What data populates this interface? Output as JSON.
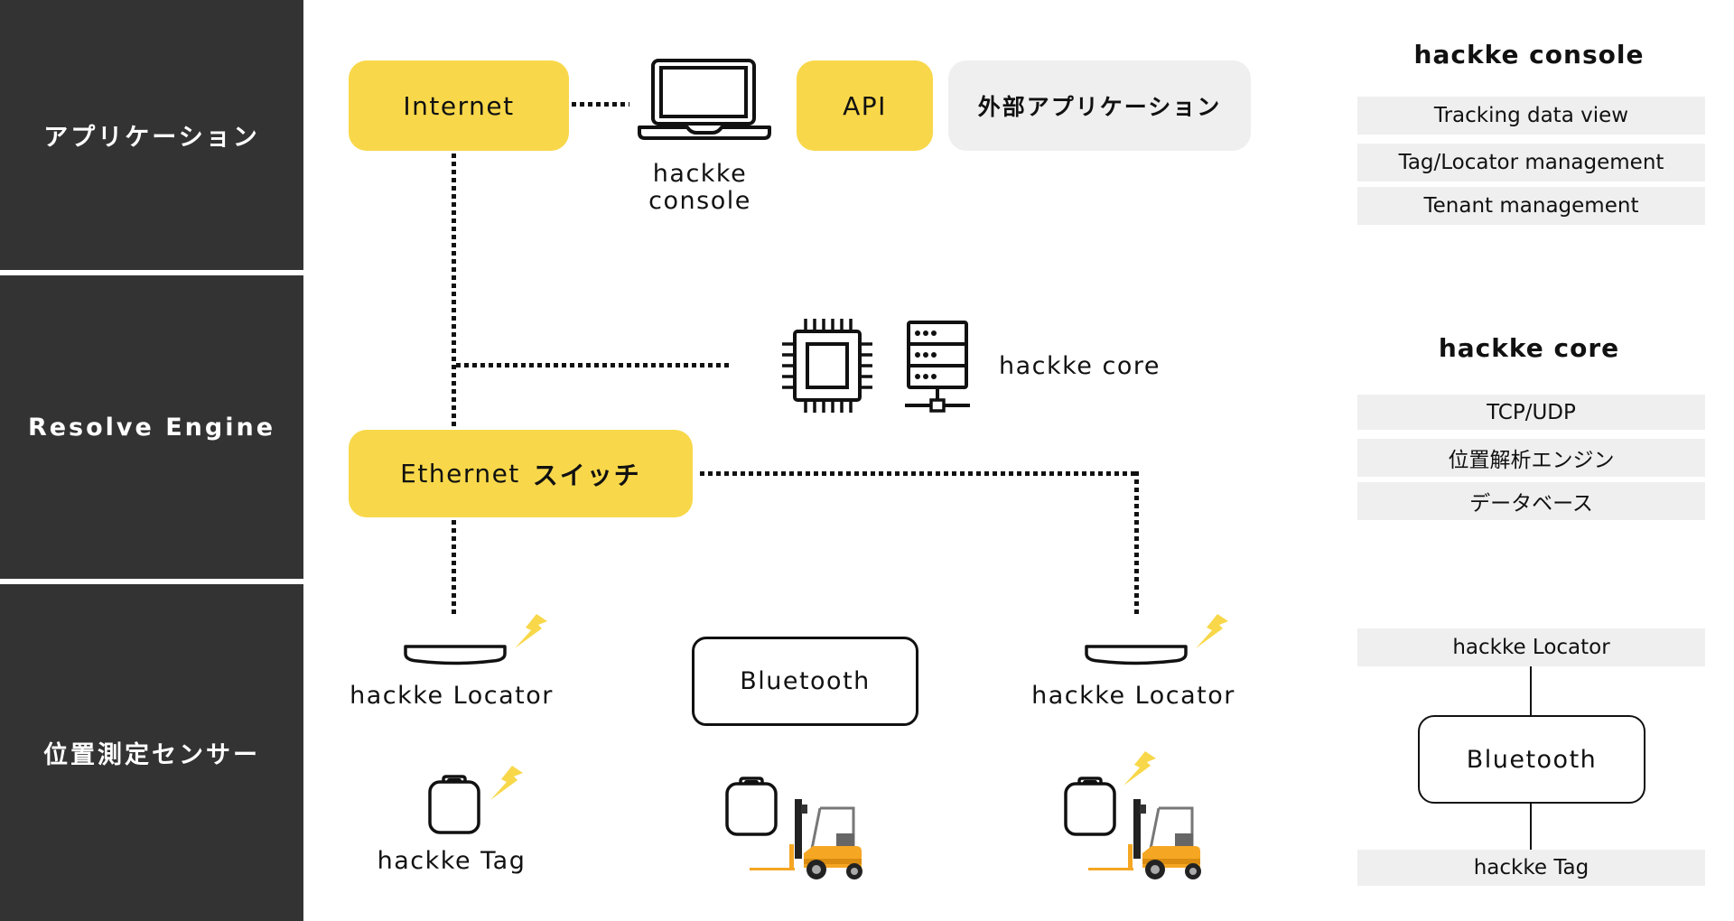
{
  "layers": [
    {
      "label": "アプリケーション"
    },
    {
      "label": "Resolve Engine"
    },
    {
      "label": "位置測定センサー"
    }
  ],
  "nodes": {
    "internet": "Internet",
    "api": "API",
    "external_app": "外部アプリケーション",
    "console_label_line1": "hackke",
    "console_label_line2": "console",
    "core_label": "hackke core",
    "ethernet_prefix": "Ethernet",
    "ethernet_suffix": "スイッチ",
    "locator_left": "hackke Locator",
    "locator_right": "hackke Locator",
    "bluetooth": "Bluetooth",
    "tag_label": "hackke Tag"
  },
  "side_panel": {
    "console": {
      "title": "hackke console",
      "items": [
        "Tracking data view",
        "Tag/Locator management",
        "Tenant management"
      ]
    },
    "core": {
      "title": "hackke core",
      "items": [
        "TCP/UDP",
        "位置解析エンジン",
        "データベース"
      ]
    },
    "sensor": {
      "top": "hackke Locator",
      "middle": "Bluetooth",
      "bottom": "hackke Tag"
    }
  },
  "icons": [
    "laptop-icon",
    "cpu-chip-icon",
    "server-icon",
    "locator-icon",
    "lightning-icon",
    "tag-icon",
    "forklift-icon"
  ],
  "colors": {
    "accent_yellow": "#f8d84a",
    "dark_panel": "#333333",
    "light_grey": "#efefef"
  }
}
